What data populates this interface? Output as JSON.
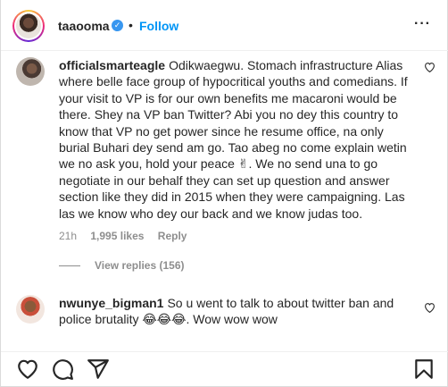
{
  "post_header": {
    "username": "taaooma",
    "follow_label": "Follow",
    "separator": "•"
  },
  "comments": [
    {
      "username": "officialsmarteagle",
      "text": "Odikwaegwu. Stomach infrastructure Alias where belle face group of hypocritical youths and comedians. If your visit to VP is for our own benefits me macaroni would be there. Shey na VP ban Twitter? Abi you no dey this country to know that VP no get power since he resume office, na only burial Buhari dey send am go. Tao abeg no come explain wetin we no ask you, hold your peace ✌. We no send una to go negotiate in our behalf they can set up question and answer section like they did in 2015 when they were campaigning. Las las we know who dey our back and we know judas too.",
      "time": "21h",
      "likes": "1,995 likes",
      "reply_label": "Reply",
      "view_replies": "View replies (156)"
    },
    {
      "username": "nwunye_bigman1",
      "text": "So u went to talk to about twitter ban and police brutality 😂😂😂. Wow wow wow"
    }
  ],
  "icons": {
    "more": "more-options-icon",
    "heart": "heart-icon",
    "comment": "comment-icon",
    "share": "share-icon",
    "save": "bookmark-icon"
  }
}
